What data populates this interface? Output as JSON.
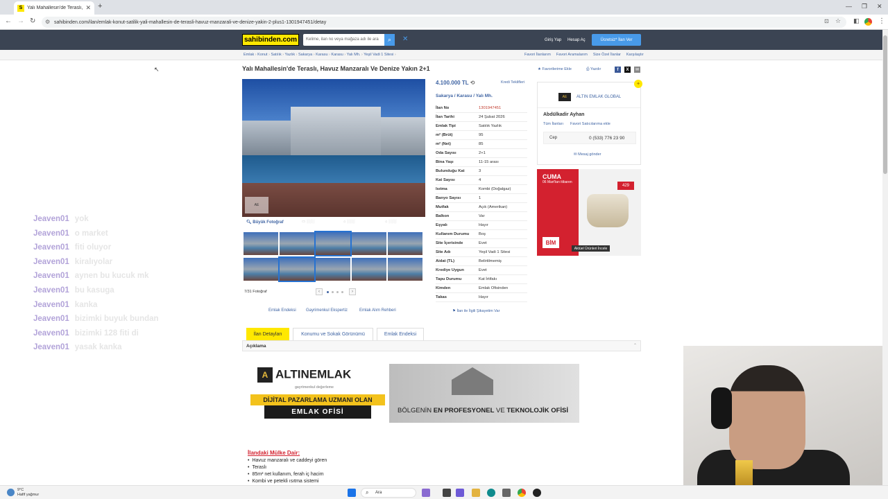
{
  "browser": {
    "tab_title": "Yalı Mahallesin'de Teraslı, Havuz M",
    "url": "sahibinden.com/ilan/emlak-konut-satilik-yali-mahallesin-de-terasli-havuz-manzarali-ve-denize-yakin-2-plus1-1301947451/detay"
  },
  "site": {
    "logo": "sahibinden.com",
    "search_placeholder": "Kelime, ilan no veya mağaza adı ile ara",
    "login": "Giriş Yap",
    "register": "Hesap Aç",
    "post_ad": "Ücretsiz* İlan Ver"
  },
  "breadcrumb": [
    "Emlak",
    "Konut",
    "Satılık",
    "Yazlık",
    "Sakarya",
    "Karasu",
    "Karasu",
    "Yalı Mh.",
    "Yeşil Vadi 1 Sitesi"
  ],
  "top_links": [
    "Favori İlanlarım",
    "Favori Aramalarım",
    "Size Özel İlanlar",
    "Karşılaştır"
  ],
  "listing": {
    "title": "Yalı Mahallesin'de Teraslı, Havuz Manzaralı Ve Denize Yakın 2+1",
    "add_favorite": "Favorilerime Ekle",
    "print": "Yazdır",
    "price": "4.100.000 TL",
    "credit": "Kredi Teklifleri",
    "location": "Sakarya / Karasu / Yalı Mh.",
    "photo_big": "Büyük Fotoğraf",
    "photo_count": "7/31 Fotoğraf",
    "below_links": [
      "Emlak Endeksi",
      "Gayrimenkul Ekspertiz",
      "Emlak Alım Rehberi"
    ],
    "complaint": "İlan ile İlgili Şikayetim Var",
    "details": [
      {
        "k": "İlan No",
        "v": "1301947451",
        "red": true
      },
      {
        "k": "İlan Tarihi",
        "v": "24 Şubat 2026"
      },
      {
        "k": "Emlak Tipi",
        "v": "Satılık Yazlık"
      },
      {
        "k": "m² (Brüt)",
        "v": "95"
      },
      {
        "k": "m² (Net)",
        "v": "85"
      },
      {
        "k": "Oda Sayısı",
        "v": "2+1"
      },
      {
        "k": "Bina Yaşı",
        "v": "11-15 arası"
      },
      {
        "k": "Bulunduğu Kat",
        "v": "3"
      },
      {
        "k": "Kat Sayısı",
        "v": "4"
      },
      {
        "k": "Isıtma",
        "v": "Kombi (Doğalgaz)"
      },
      {
        "k": "Banyo Sayısı",
        "v": "1"
      },
      {
        "k": "Mutfak",
        "v": "Açık (Amerikan)"
      },
      {
        "k": "Balkon",
        "v": "Var"
      },
      {
        "k": "Eşyalı",
        "v": "Hayır"
      },
      {
        "k": "Kullanım Durumu",
        "v": "Boş"
      },
      {
        "k": "Site İçerisinde",
        "v": "Evet"
      },
      {
        "k": "Site Adı",
        "v": "Yeşil Vadi 1 Sitesi"
      },
      {
        "k": "Aidat (TL)",
        "v": "Belirtilmemiş"
      },
      {
        "k": "Krediye Uygun",
        "v": "Evet"
      },
      {
        "k": "Tapu Durumu",
        "v": "Kat İrtifakı"
      },
      {
        "k": "Kimden",
        "v": "Emlak Ofisinden"
      },
      {
        "k": "Takas",
        "v": "Hayır"
      }
    ]
  },
  "seller": {
    "firm": "ALTIN EMLAK GLOBAL",
    "name": "Abdülkadir Ayhan",
    "all_ads": "Tüm İlanları",
    "fav_seller": "Favori Satıcılarıma ekle",
    "phone_label": "Cep",
    "phone": "0 (533) 776 23 90",
    "message": "Mesaj gönder"
  },
  "ad": {
    "day": "CUMA",
    "date": "06 Mart'tan itibaren",
    "price": "429",
    "brand": "BİM",
    "cta": "Aktüel Ürünleri İncele"
  },
  "tabs": [
    "İlan Detayları",
    "Konumu ve Sokak Görünümü",
    "Emlak Endeksi"
  ],
  "description": {
    "header": "Açıklama",
    "banner_brand": "ALTINEMLAK",
    "banner_sub": "gayrimenkul değerleme",
    "banner_yellow": "DİJİTAL PAZARLAMA UZMANI OLAN",
    "banner_black": "EMLAK OFİSİ",
    "banner_right_a": "BÖLGENİN ",
    "banner_right_b": "EN PROFESYONEL",
    "banner_right_c": " VE ",
    "banner_right_d": "TEKNOLOJİK OFİSİ",
    "section_title": "İlandaki Mülke Dair:",
    "bullets": [
      "Havuz manzaralı ve caddeyi gören",
      "Teraslı",
      "85m² net kullanım, ferah iç hacim",
      "Kombi ve petekli ısıtma sistemi"
    ]
  },
  "chat": [
    {
      "user": "Jeaven01",
      "msg": "yok"
    },
    {
      "user": "Jeaven01",
      "msg": "o market"
    },
    {
      "user": "Jeaven01",
      "msg": "fiti oluyor"
    },
    {
      "user": "Jeaven01",
      "msg": "kiralıyolar"
    },
    {
      "user": "Jeaven01",
      "msg": "aynen bu kucuk mk"
    },
    {
      "user": "Jeaven01",
      "msg": "bu kasuga"
    },
    {
      "user": "Jeaven01",
      "msg": "kanka"
    },
    {
      "user": "Jeaven01",
      "msg": "bizimki buyuk bundan"
    },
    {
      "user": "Jeaven01",
      "msg": "bizimki 128 fiti di"
    },
    {
      "user": "Jeaven01",
      "msg": "yasak kanka"
    }
  ],
  "taskbar": {
    "temp": "9°C",
    "weather": "Hafif yağmur",
    "search": "Ara"
  }
}
